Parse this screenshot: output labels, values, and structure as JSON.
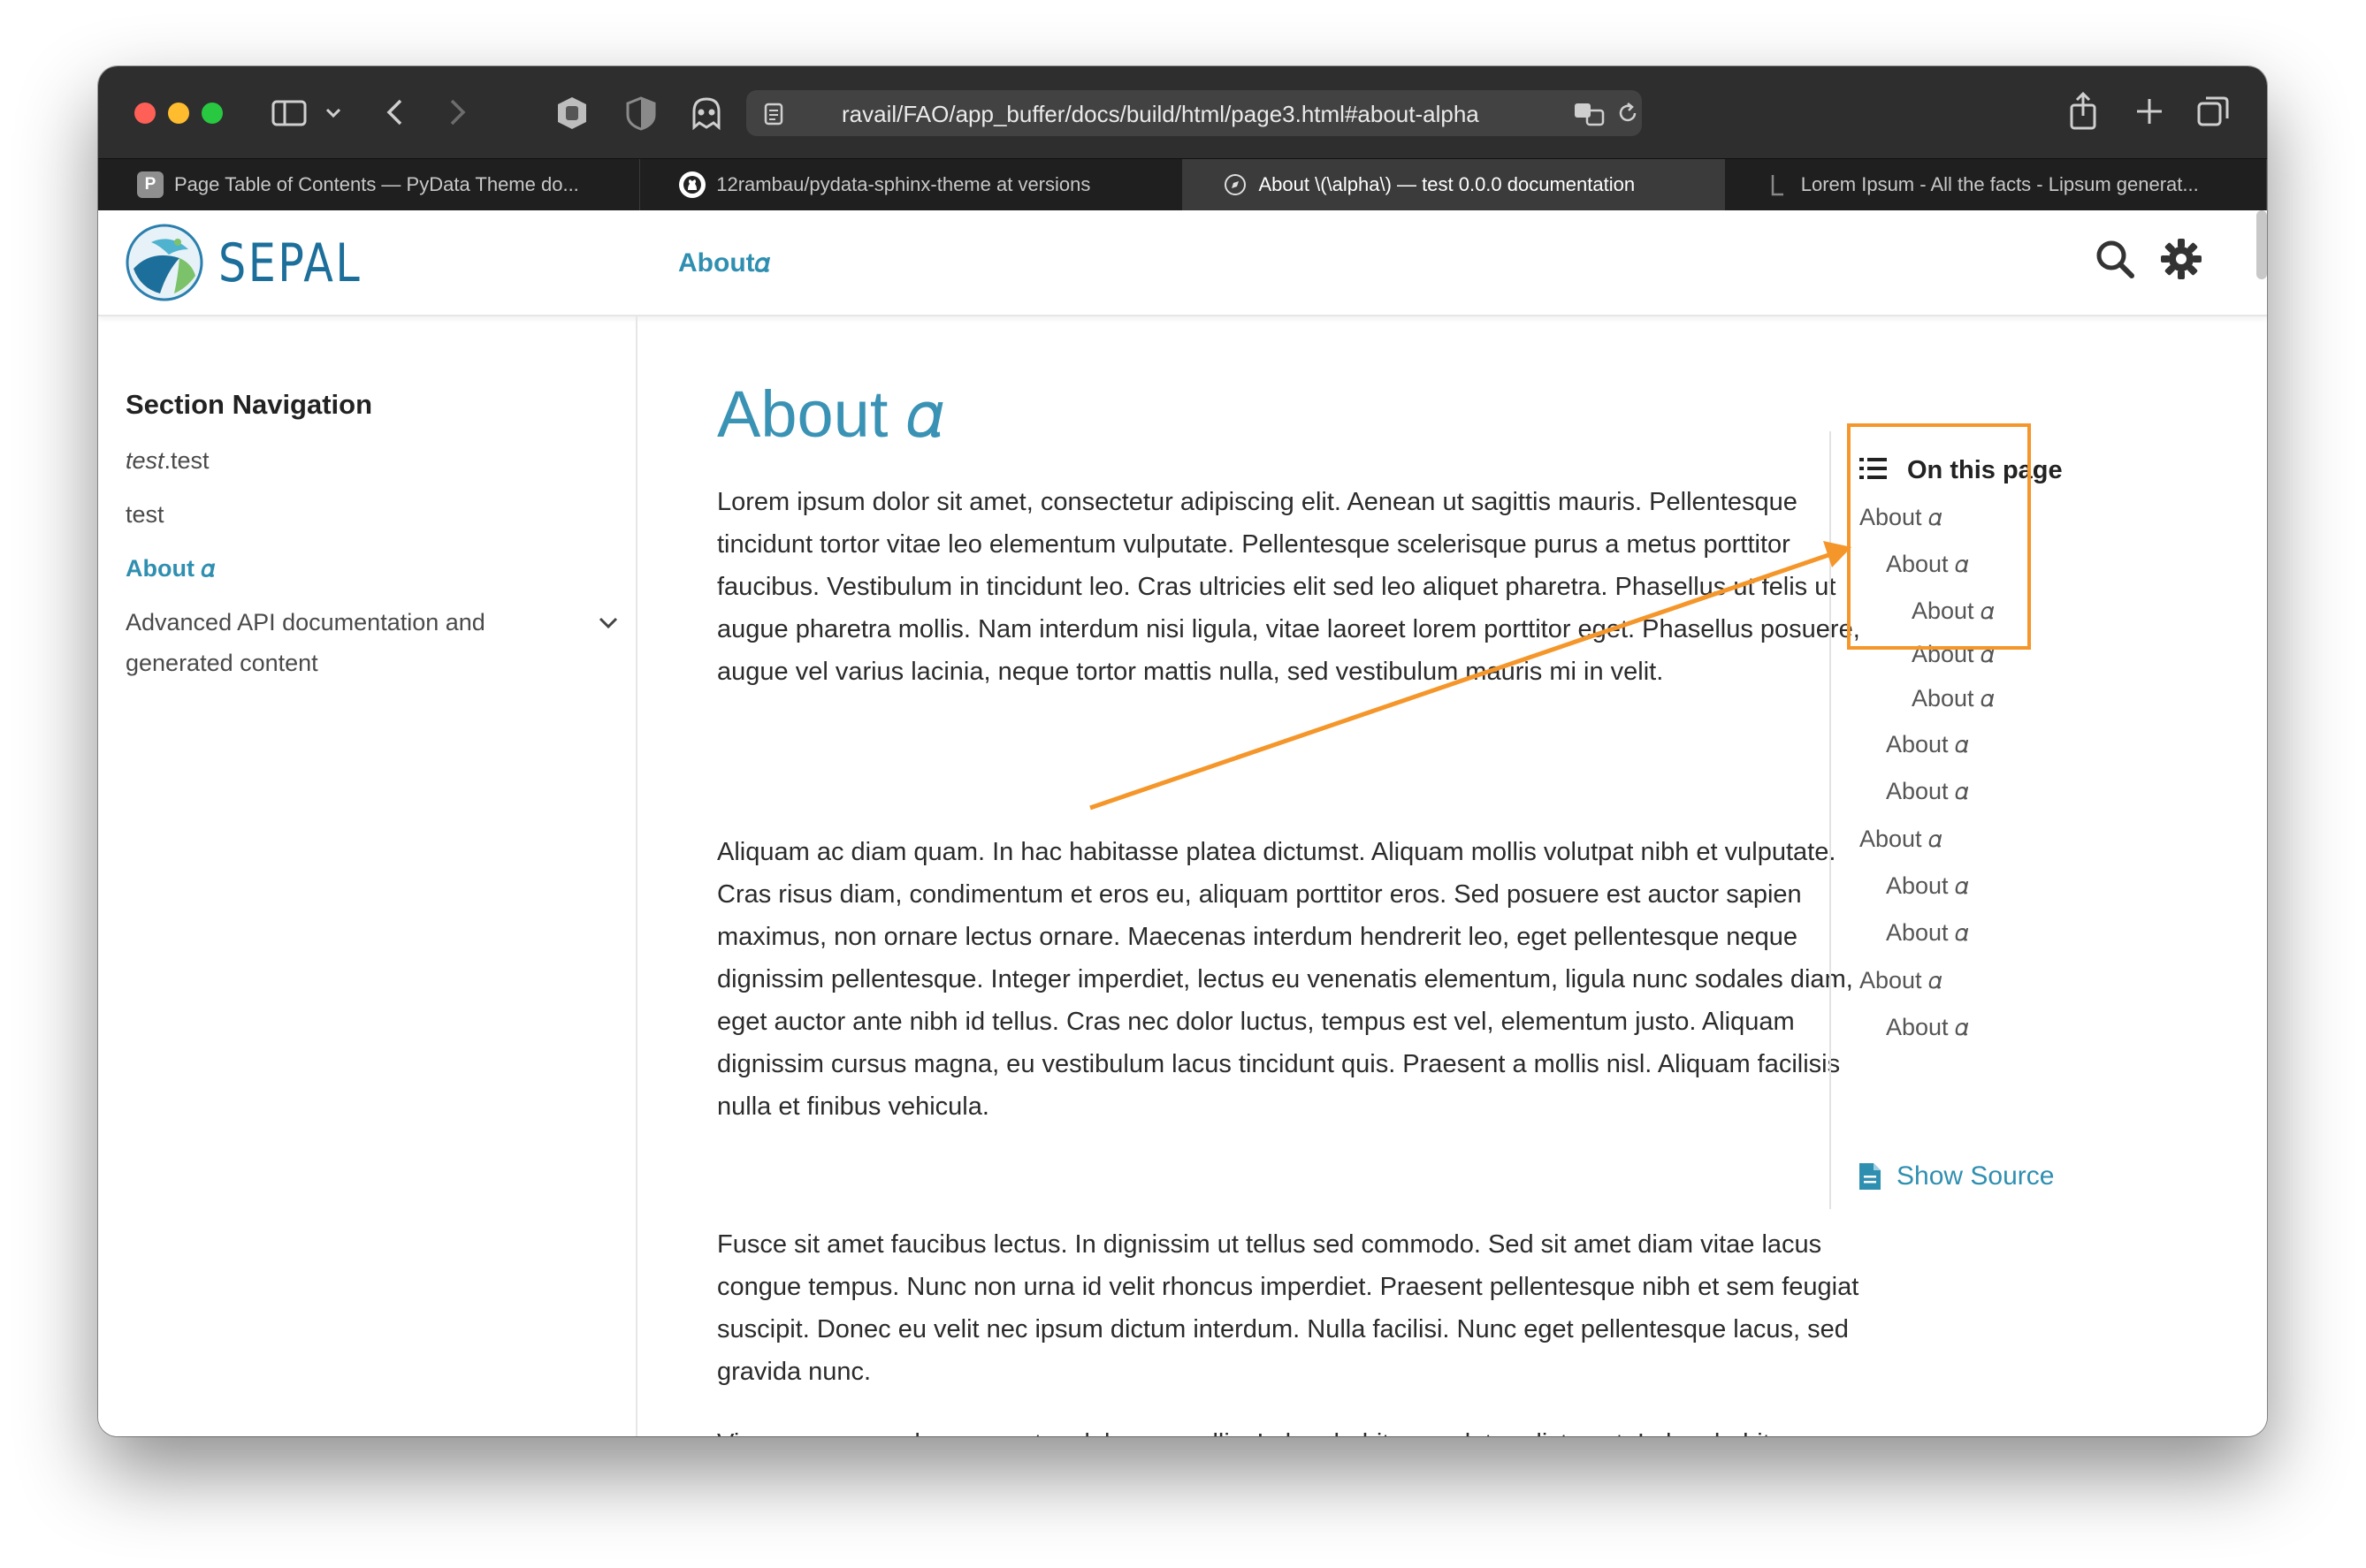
{
  "browser": {
    "url": "ravail/FAO/app_buffer/docs/build/html/page3.html#about-alpha",
    "tabs": [
      {
        "title": "Page Table of Contents — PyData Theme do...",
        "favicon": "P"
      },
      {
        "title": "12rambau/pydata-sphinx-theme at versions",
        "favicon": "github"
      },
      {
        "title": "About \\(\\alpha\\) — test 0.0.0 documentation",
        "favicon": "compass"
      },
      {
        "title": "Lorem Ipsum - All the facts - Lipsum generat...",
        "favicon": "lipsum"
      }
    ],
    "active_tab": 2
  },
  "navbar": {
    "logo_text": "SEPAL",
    "about_link": "About𝛼"
  },
  "sidebar": {
    "title": "Section Navigation",
    "items": [
      {
        "label_em": "test",
        "label_rest": ".test"
      },
      {
        "label": "test"
      },
      {
        "label": "About 𝛼"
      },
      {
        "label": "Advanced API documentation and generated content"
      }
    ]
  },
  "content": {
    "title": "About 𝛼",
    "paragraphs": [
      "Lorem ipsum dolor sit amet, consectetur adipiscing elit. Aenean ut sagittis mauris. Pellentesque tincidunt tortor vitae leo elementum vulputate. Pellentesque scelerisque purus a metus porttitor faucibus. Vestibulum in tincidunt leo. Cras ultricies elit sed leo aliquet pharetra. Phasellus ut felis ut augue pharetra mollis. Nam interdum nisi ligula, vitae laoreet lorem porttitor eget. Phasellus posuere, augue vel varius lacinia, neque tortor mattis nulla, sed vestibulum mauris mi in velit.",
      "Aliquam ac diam quam. In hac habitasse platea dictumst. Aliquam mollis volutpat nibh et vulputate. Cras risus diam, condimentum et eros eu, aliquam porttitor eros. Sed posuere est auctor sapien maximus, non ornare lectus ornare. Maecenas interdum hendrerit leo, eget pellentesque neque dignissim pellentesque. Integer imperdiet, lectus eu venenatis elementum, ligula nunc sodales diam, eget auctor ante nibh id tellus. Cras nec dolor luctus, tempus est vel, elementum justo. Aliquam dignissim cursus magna, eu vestibulum lacus tincidunt quis. Praesent a mollis nisl. Aliquam facilisis nulla et finibus vehicula.",
      "Fusce sit amet faucibus lectus. In dignissim ut tellus sed commodo. Sed sit amet diam vitae lacus congue tempus. Nunc non urna id velit rhoncus imperdiet. Praesent pellentesque nibh et sem feugiat suscipit. Donec eu velit nec ipsum dictum interdum. Nulla facilisi. Nunc eget pellentesque lacus, sed gravida nunc.",
      "Vivamus commodo augue et sodales convallis. In hac habitasse platea dictumst. In hac habitasse platea dictumst. Aenean interdum est vel consequat volutpat. Vivamus"
    ]
  },
  "toc": {
    "title": "On this page",
    "items": [
      {
        "label": "About 𝛼",
        "level": 1
      },
      {
        "label": "About 𝛼",
        "level": 2
      },
      {
        "label": "About 𝛼",
        "level": 3
      },
      {
        "label": "About 𝛼",
        "level": 3
      },
      {
        "label": "About 𝛼",
        "level": 3
      },
      {
        "label": "About 𝛼",
        "level": 2
      },
      {
        "label": "About 𝛼",
        "level": 2
      },
      {
        "label": "About 𝛼",
        "level": 1
      },
      {
        "label": "About 𝛼",
        "level": 2
      },
      {
        "label": "About 𝛼",
        "level": 2
      },
      {
        "label": "About 𝛼",
        "level": 1
      },
      {
        "label": "About 𝛼",
        "level": 2
      }
    ],
    "show_source": "Show Source"
  },
  "colors": {
    "accent": "#2f8fb1",
    "annotation": "#f5962a"
  }
}
